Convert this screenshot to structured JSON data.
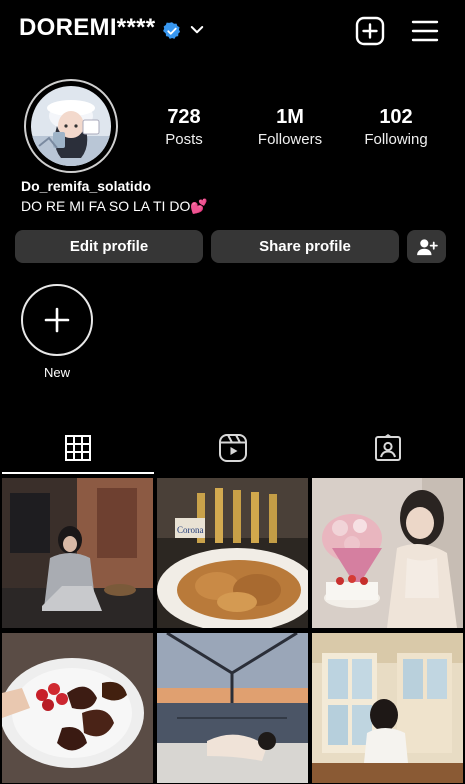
{
  "header": {
    "username": "DOREMI****",
    "verified_icon": "verified-badge-icon",
    "dropdown_icon": "chevron-down-icon",
    "new_post_icon": "plus-square-icon",
    "menu_icon": "hamburger-menu-icon"
  },
  "profile": {
    "stats": [
      {
        "value": "728",
        "label": "Posts"
      },
      {
        "value": "1M",
        "label": "Followers"
      },
      {
        "value": "102",
        "label": "Following"
      }
    ],
    "display_name": "Do_remifa_solatido",
    "bio": "DO RE MI FA SO LA TI DO💕"
  },
  "actions": {
    "edit_label": "Edit profile",
    "share_label": "Share profile",
    "discover_icon": "add-person-icon"
  },
  "highlights": [
    {
      "label": "New",
      "icon": "plus-icon"
    }
  ],
  "tabs": [
    {
      "icon": "grid-icon",
      "active": true
    },
    {
      "icon": "reels-icon",
      "active": false
    },
    {
      "icon": "tagged-icon",
      "active": false
    }
  ],
  "colors": {
    "background": "#000000",
    "button_bg": "#363636",
    "verified": "#3897f0"
  }
}
